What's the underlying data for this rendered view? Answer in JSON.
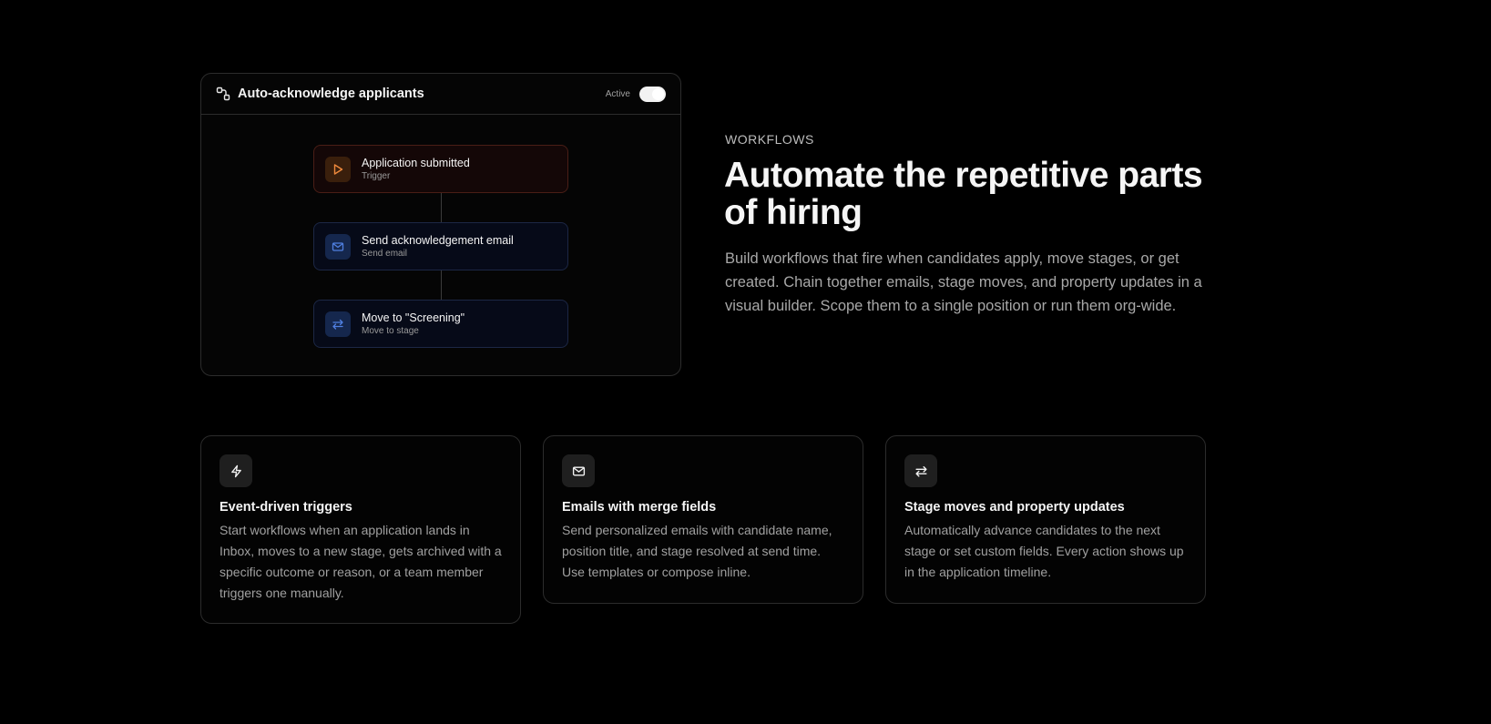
{
  "workflow": {
    "title": "Auto-acknowledge applicants",
    "status_label": "Active",
    "toggle_on": true,
    "nodes": [
      {
        "title": "Application submitted",
        "subtitle": "Trigger",
        "icon": "play-icon",
        "color": "#f08a3c"
      },
      {
        "title": "Send acknowledgement email",
        "subtitle": "Send email",
        "icon": "mail-icon",
        "color": "#4f7fe0"
      },
      {
        "title": "Move to \"Screening\"",
        "subtitle": "Move to stage",
        "icon": "arrows-swap-icon",
        "color": "#4f7fe0"
      }
    ]
  },
  "section": {
    "eyebrow": "WORKFLOWS",
    "headline": "Automate the repetitive parts of hiring",
    "description": "Build workflows that fire when candidates apply, move stages, or get created. Chain together emails, stage moves, and property updates in a visual builder. Scope them to a single position or run them org-wide."
  },
  "features": [
    {
      "icon": "lightning-icon",
      "title": "Event-driven triggers",
      "description": "Start workflows when an application lands in Inbox, moves to a new stage, gets archived with a specific outcome or reason, or a team member triggers one manually."
    },
    {
      "icon": "mail-icon",
      "title": "Emails with merge fields",
      "description": "Send personalized emails with candidate name, position title, and stage resolved at send time. Use templates or compose inline."
    },
    {
      "icon": "arrows-swap-icon",
      "title": "Stage moves and property updates",
      "description": "Automatically advance candidates to the next stage or set custom fields. Every action shows up in the application timeline."
    }
  ],
  "colors": {
    "background": "#000000",
    "trigger_accent": "#f08a3c",
    "action_accent": "#4f7fe0"
  }
}
